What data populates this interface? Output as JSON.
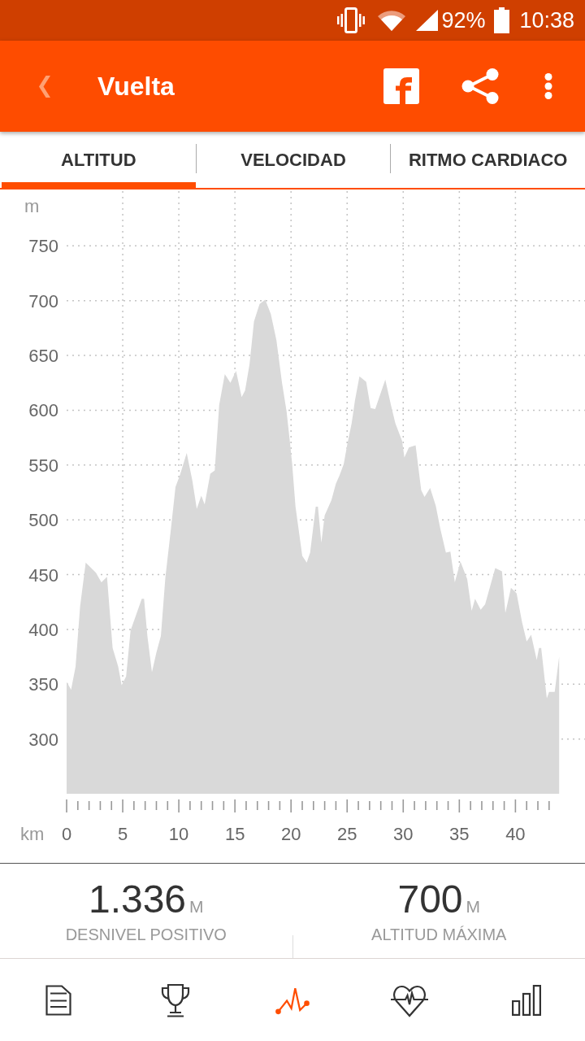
{
  "status_bar": {
    "battery": "92%",
    "time": "10:38"
  },
  "app_bar": {
    "title": "Vuelta"
  },
  "tabs": [
    {
      "label": "ALTITUD",
      "selected": true
    },
    {
      "label": "VELOCIDAD",
      "selected": false
    },
    {
      "label": "RITMO CARDIACO",
      "selected": false
    }
  ],
  "chart": {
    "chart_data": {
      "type": "area",
      "xlabel": "km",
      "ylabel": "m",
      "x": [
        0,
        0.4,
        0.8,
        1.2,
        1.7,
        2.6,
        3.1,
        3.6,
        4.1,
        4.6,
        4.9,
        5.3,
        5.7,
        6.7,
        6.9,
        7.2,
        7.6,
        8.0,
        8.4,
        8.8,
        9.3,
        9.7,
        10.1,
        10.7,
        11.2,
        11.6,
        12.0,
        12.3,
        12.8,
        13.2,
        13.6,
        14.1,
        14.6,
        15.1,
        15.6,
        15.9,
        16.3,
        16.7,
        17.2,
        17.7,
        18.2,
        18.7,
        19.2,
        19.6,
        19.9,
        20.1,
        20.4,
        21.0,
        21.4,
        21.7,
        22.2,
        22.4,
        22.7,
        23.0,
        23.6,
        24.0,
        24.3,
        24.7,
        25.0,
        25.4,
        25.7,
        26.1,
        26.7,
        27.1,
        27.5,
        28.4,
        28.9,
        29.3,
        29.9,
        30.1,
        30.5,
        31.1,
        31.6,
        31.9,
        32.4,
        32.9,
        33.3,
        33.8,
        34.2,
        34.6,
        35.1,
        35.7,
        36.1,
        36.4,
        36.9,
        37.3,
        38.2,
        38.8,
        39.1,
        39.6,
        40.1,
        40.6,
        41.0,
        41.4,
        41.9,
        42.1,
        42.3,
        42.8,
        43.0,
        43.5,
        43.9
      ],
      "values": [
        352,
        345,
        366,
        421,
        461,
        452,
        443,
        448,
        383,
        366,
        349,
        357,
        399,
        428,
        428,
        394,
        361,
        379,
        394,
        447,
        492,
        530,
        541,
        561,
        536,
        510,
        522,
        514,
        542,
        545,
        605,
        633,
        625,
        636,
        612,
        618,
        642,
        681,
        697,
        701,
        688,
        664,
        625,
        599,
        571,
        551,
        512,
        467,
        461,
        470,
        512,
        512,
        479,
        504,
        518,
        533,
        540,
        551,
        568,
        588,
        609,
        631,
        626,
        602,
        601,
        628,
        605,
        588,
        572,
        557,
        566,
        568,
        527,
        521,
        529,
        513,
        492,
        470,
        471,
        443,
        462,
        446,
        417,
        428,
        418,
        423,
        456,
        453,
        415,
        438,
        433,
        406,
        389,
        395,
        372,
        383,
        383,
        337,
        343,
        343,
        375
      ],
      "xlim": [
        0,
        46.2
      ],
      "ylim": [
        250,
        800
      ],
      "xticks": [
        0,
        5,
        10,
        15,
        20,
        25,
        30,
        35,
        40
      ],
      "yticks": [
        300,
        350,
        400,
        450,
        500,
        550,
        600,
        650,
        700,
        750
      ],
      "grid": true
    }
  },
  "stats": [
    {
      "value": "1.336",
      "unit": "M",
      "label": "DESNIVEL POSITIVO"
    },
    {
      "value": "700",
      "unit": "M",
      "label": "ALTITUD MÁXIMA"
    }
  ],
  "bottom_nav": [
    {
      "kind": "document",
      "selected": false
    },
    {
      "kind": "trophy",
      "selected": false
    },
    {
      "kind": "graph",
      "selected": true
    },
    {
      "kind": "heartbeat",
      "selected": false
    },
    {
      "kind": "bars",
      "selected": false
    }
  ]
}
